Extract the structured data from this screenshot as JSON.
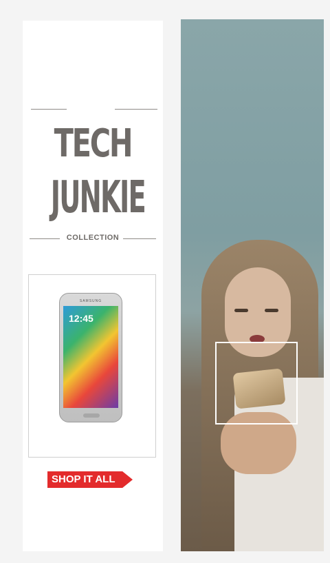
{
  "brand": {
    "title_line1": "TECH",
    "title_line2": "JUNKIE",
    "subtitle": "COLLECTION"
  },
  "product": {
    "phone_brand_text": "SAMSUNG",
    "screen_time": "12:45"
  },
  "cta": {
    "label": "SHOP IT ALL"
  },
  "colors": {
    "cta_bg": "#e32b2c",
    "title_text": "#6e6a67"
  }
}
